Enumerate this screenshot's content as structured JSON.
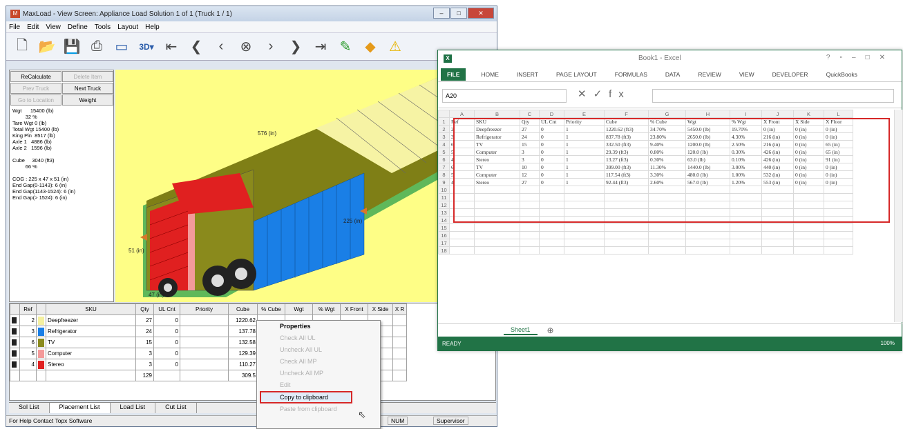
{
  "maxload": {
    "title": "MaxLoad - View Screen: Appliance Load Solution 1 of 1 (Truck 1 / 1)",
    "menu": [
      "File",
      "Edit",
      "View",
      "Define",
      "Tools",
      "Layout",
      "Help"
    ],
    "buttons": {
      "recalc": "ReCalculate",
      "delete_item": "Delete Item",
      "prev_truck": "Prev Truck",
      "next_truck": "Next Truck",
      "go_to_location": "Go to Location",
      "weight": "Weight"
    },
    "stats": "Wgt      15400 (lb)\n         32 %\nTare Wgt 0 (lb)\nTotal Wgt 15400 (lb)\nKing Pin  8517 (lb)\nAxle 1   4886 (lb)\nAxle 2   1596 (lb)\n\nCube     3040 (ft3)\n         66 %\n\nCOG : 225 x 47 x 51 (in)\nEnd Gap(0-1143): 6 (in)\nEnd Gap(1143-1524): 6 (in)\nEnd Gap(> 1524): 6 (in)",
    "dims": {
      "length": "576 (in)",
      "mid": "225 (in)",
      "height": "51 (in)",
      "bottom": "47 (in)"
    },
    "grid_headers": [
      "",
      "Ref",
      "",
      "SKU",
      "Qty",
      "UL Cnt",
      "Priority",
      "Cube",
      "% Cube",
      "Wgt",
      "% Wgt",
      "X Front",
      "X Side",
      "X R"
    ],
    "grid_rows": [
      {
        "ref": "2",
        "sku": "Deepfreezer",
        "qty": "27",
        "ul": "0",
        "cube": "1220.62",
        "color": "#f4f0a0"
      },
      {
        "ref": "3",
        "sku": "Refrigerator",
        "qty": "24",
        "ul": "0",
        "cube": "137.78",
        "color": "#1a7fe6"
      },
      {
        "ref": "6",
        "sku": "TV",
        "qty": "15",
        "ul": "0",
        "cube": "132.58",
        "color": "#8a8a1c"
      },
      {
        "ref": "5",
        "sku": "Computer",
        "qty": "3",
        "ul": "0",
        "cube": "129.39",
        "color": "#f49a9a"
      },
      {
        "ref": "4",
        "sku": "Stereo",
        "qty": "3",
        "ul": "0",
        "cube": "110.27",
        "color": "#e02020"
      }
    ],
    "grid_total": {
      "qty": "129",
      "cube": "309.5"
    },
    "tabs": [
      "Sol List",
      "Placement List",
      "Load List",
      "Cut List"
    ],
    "status": {
      "help": "For Help Contact Topx Software",
      "num": "NUM",
      "sup": "Supervisor"
    }
  },
  "context_menu": {
    "items": [
      {
        "label": "Properties",
        "enabled": true
      },
      {
        "label": "Check All UL",
        "enabled": false
      },
      {
        "label": "Uncheck All UL",
        "enabled": false
      },
      {
        "label": "Check All MP",
        "enabled": false
      },
      {
        "label": "Uncheck All MP",
        "enabled": false
      },
      {
        "label": "Edit",
        "enabled": false
      }
    ],
    "selected": "Copy to clipboard",
    "last": "Paste from clipboard"
  },
  "excel": {
    "title": "Book1 - Excel",
    "tabs": [
      "HOME",
      "INSERT",
      "PAGE LAYOUT",
      "FORMULAS",
      "DATA",
      "REVIEW",
      "VIEW",
      "DEVELOPER",
      "QuickBooks"
    ],
    "file_tab": "FILE",
    "name_box": "A20",
    "columns": [
      "",
      "A",
      "B",
      "C",
      "D",
      "E",
      "F",
      "G",
      "H",
      "I",
      "J",
      "K",
      "L"
    ],
    "header_row": [
      "Ref",
      "SKU",
      "Qty",
      "UL Cnt",
      "Priority",
      "Cube",
      "% Cube",
      "Wgt",
      "% Wgt",
      "X Front",
      "X Side",
      "X Floor"
    ],
    "rows": [
      [
        "2",
        "Deepfreezer",
        "27",
        "0",
        "1",
        "1220.62 (ft3)",
        "34.70%",
        "5450.0 (lb)",
        "19.70%",
        "0 (in)",
        "0 (in)",
        "0 (in)"
      ],
      [
        "3",
        "Refrigerator",
        "24",
        "0",
        "1",
        "837.78 (ft3)",
        "23.80%",
        "2650.0 (lb)",
        "4.30%",
        "216 (in)",
        "0 (in)",
        "0 (in)"
      ],
      [
        "6",
        "TV",
        "15",
        "0",
        "1",
        "332.50 (ft3)",
        "9.40%",
        "1200.0 (lb)",
        "2.50%",
        "216 (in)",
        "0 (in)",
        "65 (in)"
      ],
      [
        "5",
        "Computer",
        "3",
        "0",
        "1",
        "29.39 (ft3)",
        "0.80%",
        "120.0 (lb)",
        "0.30%",
        "426 (in)",
        "0 (in)",
        "65 (in)"
      ],
      [
        "4",
        "Stereo",
        "3",
        "0",
        "1",
        "13.27 (ft3)",
        "0.30%",
        "63.0 (lb)",
        "0.10%",
        "426 (in)",
        "0 (in)",
        "91 (in)"
      ],
      [
        "6",
        "TV",
        "10",
        "0",
        "1",
        "399.00 (ft3)",
        "11.30%",
        "1440.0 (lb)",
        "3.00%",
        "440 (in)",
        "0 (in)",
        "0 (in)"
      ],
      [
        "5",
        "Computer",
        "12",
        "0",
        "1",
        "117.54 (ft3)",
        "3.30%",
        "480.0 (lb)",
        "1.00%",
        "532 (in)",
        "0 (in)",
        "0 (in)"
      ],
      [
        "4",
        "Stereo",
        "27",
        "0",
        "1",
        "92.44 (ft3)",
        "2.60%",
        "567.0 (lb)",
        "1.20%",
        "553 (in)",
        "0 (in)",
        "0 (in)"
      ]
    ],
    "sheet_tab": "Sheet1",
    "status": "READY",
    "zoom": "100%"
  }
}
